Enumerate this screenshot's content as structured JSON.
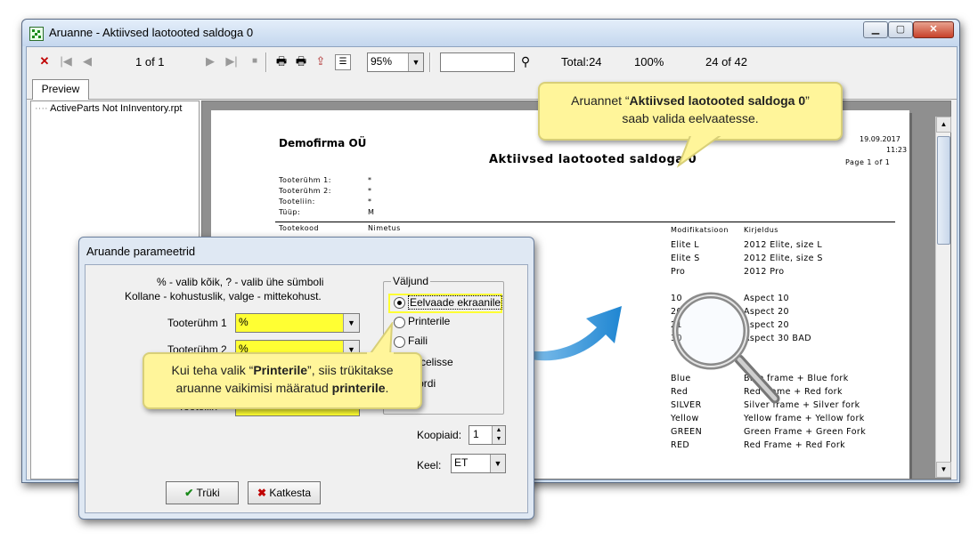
{
  "window": {
    "title": "Aruanne - Aktiivsed laotooted saldoga 0",
    "controls": {
      "minimize": "▁",
      "maximize": "▢",
      "close": "✕"
    }
  },
  "toolbar": {
    "page_indicator": "1 of 1",
    "zoom_value": "95%",
    "search_value": "",
    "total": "Total:24",
    "percent": "100%",
    "count": "24 of 42",
    "icons": [
      "close-icon",
      "first-page-icon",
      "prev-page-icon",
      "next-page-icon",
      "last-page-icon",
      "stop-icon",
      "print-icon",
      "print-setup-icon",
      "export-icon",
      "tree-toggle-icon",
      "binoculars-icon"
    ]
  },
  "tabs": {
    "preview": "Preview"
  },
  "tree": {
    "item": "ActiveParts Not InInventory.rpt"
  },
  "report": {
    "company": "Demofirma OÜ",
    "title": "Aktiivsed laotooted saldoga 0",
    "date": "19.09.2017",
    "time": "11:23",
    "page": "Page 1 of 1",
    "filters": [
      {
        "label": "Tooterühm 1:",
        "value": "*"
      },
      {
        "label": "Tooterühm 2:",
        "value": "*"
      },
      {
        "label": "Tooteliin:",
        "value": "*"
      },
      {
        "label": "Tüüp:",
        "value": "M"
      }
    ],
    "header_partial_left": "Tootekood",
    "header_partial_mid": "Nimetus",
    "col_mod": "Modifikatsioon",
    "col_desc": "Kirjeldus",
    "rows": [
      [
        "Elite L",
        "2012 Elite, size L"
      ],
      [
        "Elite S",
        "2012 Elite, size S"
      ],
      [
        "Pro",
        "2012 Pro"
      ],
      [
        "",
        ""
      ],
      [
        "10",
        "Aspect 10"
      ],
      [
        "20",
        "Aspect 20"
      ],
      [
        "21",
        "Aspect 20"
      ],
      [
        "30",
        "Aspect 30 BAD"
      ],
      [
        "",
        ""
      ],
      [
        "",
        ""
      ],
      [
        "Blue",
        "Blue frame + Blue fork"
      ],
      [
        "Red",
        "Red frame + Red fork"
      ],
      [
        "SILVER",
        "Silver frame + Silver fork"
      ],
      [
        "Yellow",
        "Yellow frame + Yellow fork"
      ],
      [
        "GREEN",
        "Green Frame + Green Fork"
      ],
      [
        "RED",
        "Red Frame + Red Fork"
      ]
    ]
  },
  "callout_top": {
    "prefix": "Aruannet “",
    "bold": "Aktiivsed laotooted saldoga 0",
    "suffix": "”",
    "line2": "saab valida eelvaatesse."
  },
  "callout_bottom": {
    "prefix": "Kui teha valik “",
    "bold1": "Printerile",
    "mid": "”, siis trükitakse",
    "line2_prefix": "aruanne vaikimisi määratud ",
    "bold2": "printerile",
    "line2_suffix": "."
  },
  "dialog": {
    "title": "Aruande parameetrid",
    "hint1": "% - valib kõik, ? - valib ühe sümboli",
    "hint2": "Kollane - kohustuslik, valge - mittekohust.",
    "field1_label": "Tooterühm 1",
    "field1_value": "%",
    "field2_label": "Tooterühm 2",
    "field2_value": "%",
    "field3_label": "Tooteliin",
    "output_group": "Väljund",
    "output_options": [
      "Eelvaade ekraanile",
      "Printerile",
      "Faili",
      "Excelisse",
      "Wordi"
    ],
    "copies_label": "Koopiaid:",
    "copies_value": "1",
    "lang_label": "Keel:",
    "lang_value": "ET",
    "print_button": "Trüki",
    "cancel_button": "Katkesta"
  },
  "colors": {
    "highlight": "#ffff33",
    "callout": "#fff59a",
    "arrow": "#2b8fd6"
  }
}
